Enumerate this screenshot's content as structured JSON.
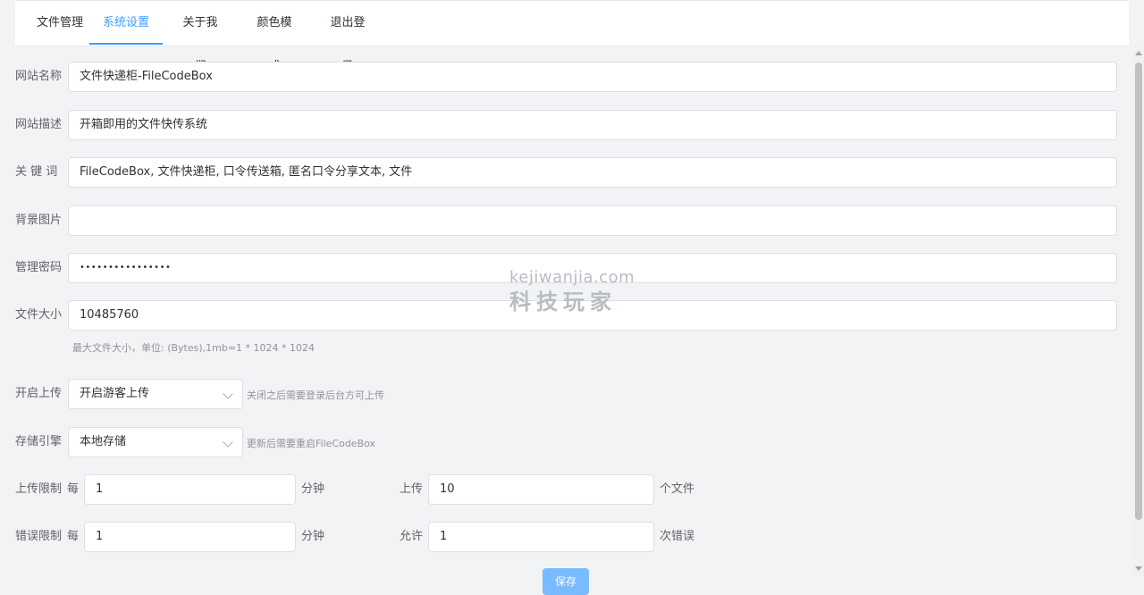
{
  "tabs": [
    {
      "label": "文件管理"
    },
    {
      "label": "系统设置"
    },
    {
      "label": "关于我们"
    },
    {
      "label": "颜色模式"
    },
    {
      "label": "退出登录"
    }
  ],
  "form": {
    "site_name": {
      "label": "网站名称",
      "value": "文件快递柜-FileCodeBox"
    },
    "site_desc": {
      "label": "网站描述",
      "value": "开箱即用的文件快传系统"
    },
    "keywords": {
      "label": "关 键 词",
      "value": "FileCodeBox, 文件快递柜, 口令传送箱, 匿名口令分享文本, 文件"
    },
    "bg_image": {
      "label": "背景图片",
      "value": ""
    },
    "admin_password": {
      "label": "管理密码",
      "value": "••••••••••••••••"
    },
    "file_size": {
      "label": "文件大小",
      "value": "10485760",
      "hint": "最大文件大小，单位: (Bytes),1mb=1 * 1024 * 1024"
    },
    "enable_upload": {
      "label": "开启上传",
      "value": "开启游客上传",
      "hint": "关闭之后需要登录后台方可上传"
    },
    "storage": {
      "label": "存储引擎",
      "value": "本地存储",
      "hint": "更新后需要重启FileCodeBox"
    },
    "upload_limit": {
      "label": "上传限制",
      "prefix": "每",
      "minutes": "1",
      "unit_minute": "分钟",
      "middle": "上传",
      "count": "10",
      "unit_count": "个文件"
    },
    "error_limit": {
      "label": "错误限制",
      "prefix": "每",
      "minutes": "1",
      "unit_minute": "分钟",
      "middle": "允许",
      "count": "1",
      "unit_count": "次错误"
    }
  },
  "watermark": {
    "line1": "kejiwanjia.com",
    "line2": "科技玩家"
  },
  "save_label": "保存",
  "colors": {
    "accent": "#409eff",
    "border": "#dcdfe6",
    "bg": "#f2f3f5"
  }
}
